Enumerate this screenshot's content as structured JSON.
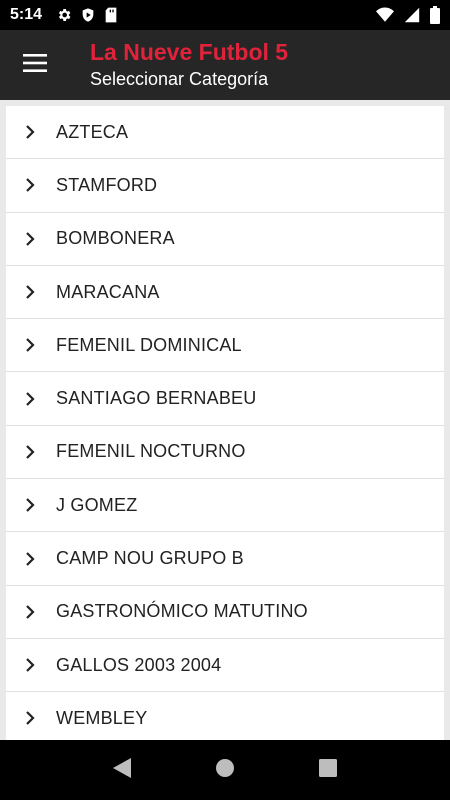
{
  "status_bar": {
    "time": "5:14",
    "left_icons": [
      "gear-icon",
      "shield-icon",
      "sd-card-icon"
    ],
    "right_icons": [
      "wifi-icon",
      "cell-signal-icon",
      "battery-icon"
    ]
  },
  "app_bar": {
    "title": "La Nueve Futbol 5",
    "subtitle": "Seleccionar Categoría",
    "title_color": "#e0233b"
  },
  "categories": [
    {
      "label": "AZTECA"
    },
    {
      "label": "STAMFORD"
    },
    {
      "label": "BOMBONERA"
    },
    {
      "label": "MARACANA"
    },
    {
      "label": "FEMENIL DOMINICAL"
    },
    {
      "label": "SANTIAGO BERNABEU"
    },
    {
      "label": "FEMENIL NOCTURNO"
    },
    {
      "label": "J GOMEZ"
    },
    {
      "label": "CAMP NOU GRUPO B"
    },
    {
      "label": "GASTRONÓMICO MATUTINO"
    },
    {
      "label": "GALLOS 2003 2004"
    },
    {
      "label": "WEMBLEY"
    }
  ],
  "nav_bar": {
    "buttons": [
      "back-icon",
      "home-icon",
      "recents-icon"
    ]
  }
}
